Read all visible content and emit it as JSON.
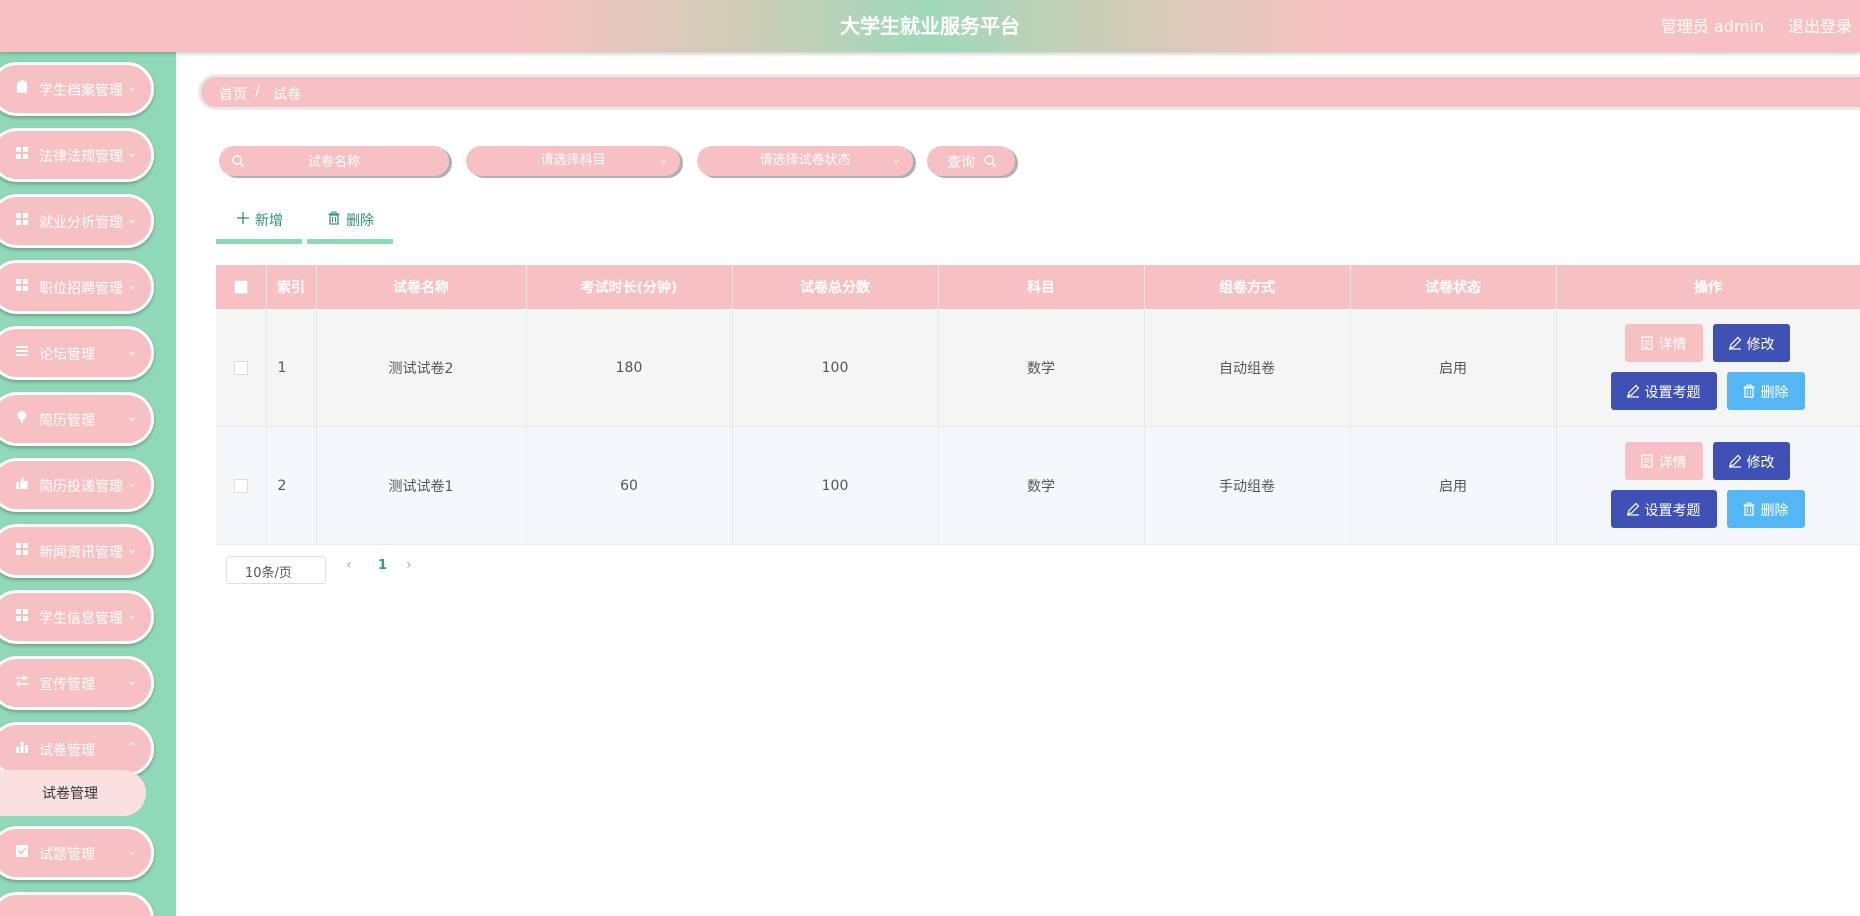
{
  "header": {
    "title": "大学生就业服务平台",
    "user": "管理员 admin",
    "logout": "退出登录"
  },
  "sidebar": {
    "items": [
      {
        "label": "学生档案管理",
        "icon": "clipboard-icon"
      },
      {
        "label": "法律法规管理",
        "icon": "grid-icon"
      },
      {
        "label": "就业分析管理",
        "icon": "grid-icon"
      },
      {
        "label": "职位招聘管理",
        "icon": "grid-icon"
      },
      {
        "label": "论坛管理",
        "icon": "list-icon"
      },
      {
        "label": "简历管理",
        "icon": "pin-icon"
      },
      {
        "label": "简历投递管理",
        "icon": "thumb-up-icon"
      },
      {
        "label": "新闻资讯管理",
        "icon": "grid-icon"
      },
      {
        "label": "学生信息管理",
        "icon": "grid-icon"
      },
      {
        "label": "宣传管理",
        "icon": "sliders-icon"
      },
      {
        "label": "试卷管理",
        "icon": "bar-chart-icon"
      },
      {
        "label": "试题管理",
        "icon": "checkbox-icon"
      }
    ],
    "sub_item": "试卷管理"
  },
  "breadcrumb": {
    "home": "首页",
    "separator": "/",
    "current": "试卷"
  },
  "search": {
    "name_placeholder": "试卷名称",
    "subject_placeholder": "请选择科目",
    "status_placeholder": "请选择试卷状态",
    "query_label": "查询"
  },
  "actions": {
    "add_label": "新增",
    "delete_label": "删除"
  },
  "table": {
    "headers": [
      "索引",
      "试卷名称",
      "考试时长(分钟)",
      "试卷总分数",
      "科目",
      "组卷方式",
      "试卷状态",
      "操作"
    ],
    "rows": [
      {
        "index": "1",
        "name": "测试试卷2",
        "duration": "180",
        "score": "100",
        "subject": "数学",
        "method": "自动组卷",
        "status": "启用"
      },
      {
        "index": "2",
        "name": "测试试卷1",
        "duration": "60",
        "score": "100",
        "subject": "数学",
        "method": "手动组卷",
        "status": "启用"
      }
    ],
    "ops": {
      "detail": "详情",
      "edit": "修改",
      "set_questions": "设置考题",
      "delete": "删除"
    }
  },
  "pagination": {
    "page_size": "10条/页",
    "current_page": "1"
  },
  "colors": {
    "pink": "#f7c1c3",
    "green": "#8fd8b8",
    "indigo": "#3f51b5",
    "sky": "#55b6f5"
  }
}
